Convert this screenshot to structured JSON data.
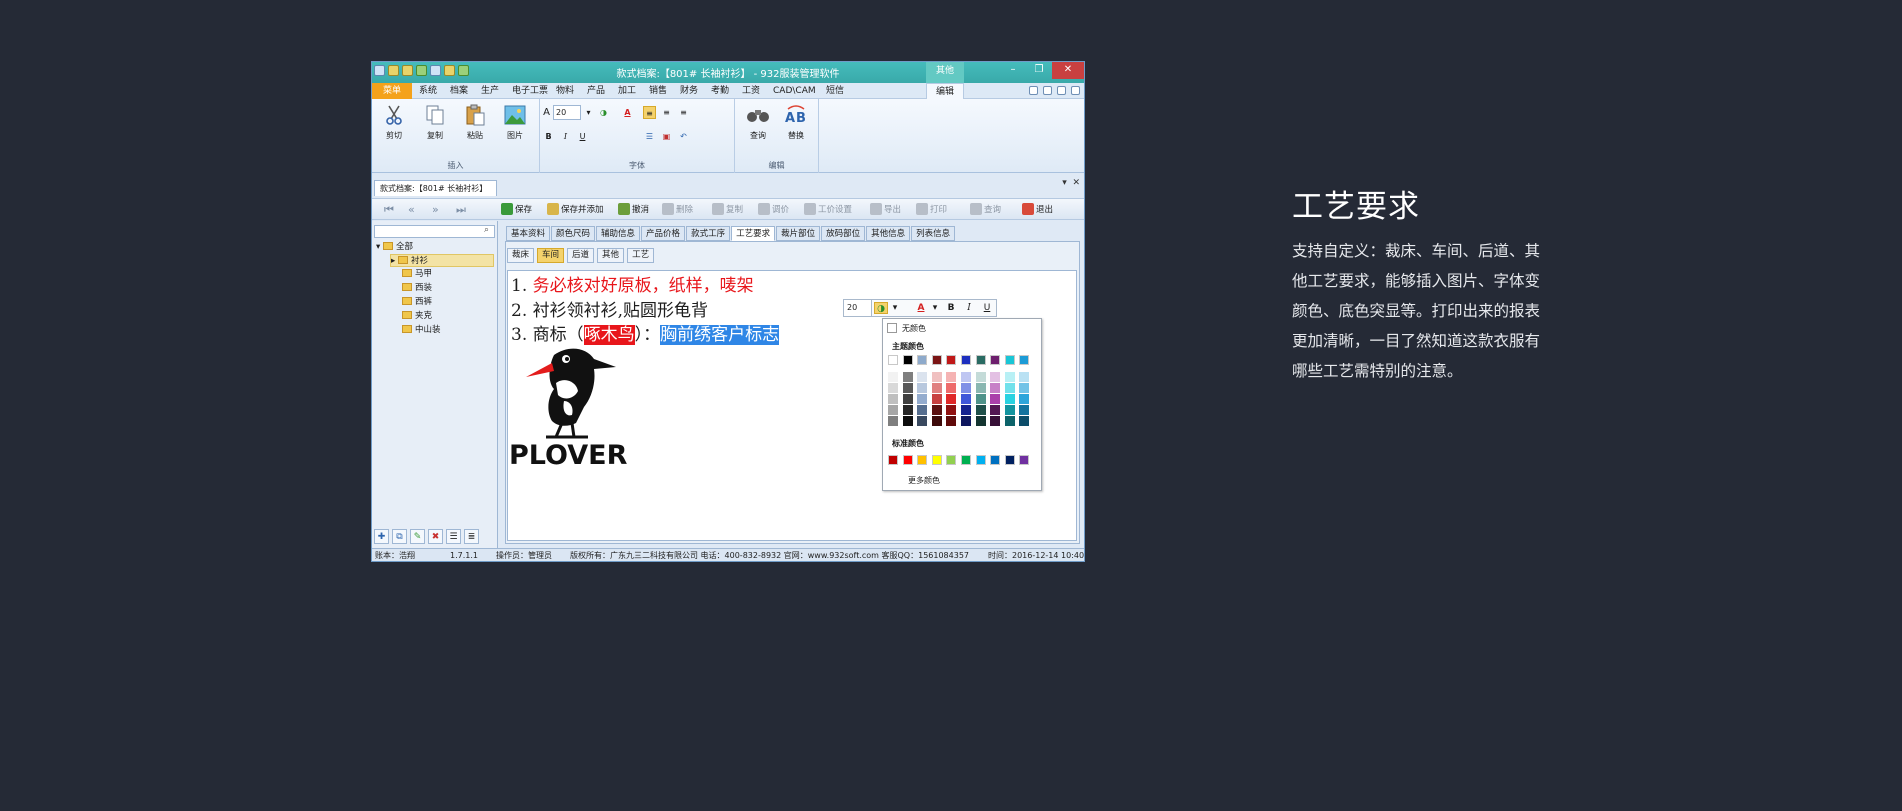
{
  "window": {
    "title": "款式档案:【801# 长袖衬衫】 - 932服装管理软件",
    "context_tab": "其他",
    "controls": [
      "–",
      "❐",
      "✕"
    ]
  },
  "menu": {
    "file": "菜单",
    "items": [
      "系统",
      "档案",
      "生产",
      "电子工票",
      "物料",
      "产品",
      "加工",
      "销售",
      "财务",
      "考勤",
      "工资",
      "CAD\\CAM",
      "短信",
      "编辑"
    ],
    "active": "编辑"
  },
  "ribbon": {
    "insert_group": {
      "label": "插入",
      "buttons": [
        "剪切",
        "复制",
        "粘贴",
        "图片"
      ]
    },
    "font_group": {
      "label": "字体",
      "size": "20",
      "bold": "B",
      "italic": "I",
      "underline": "U"
    },
    "edit_group": {
      "label": "编辑",
      "buttons": [
        "查询",
        "替换"
      ]
    }
  },
  "doc_tab": {
    "label": "款式档案:【801# 长袖衬衫】"
  },
  "toolbar": {
    "save": "保存",
    "save_add": "保存并添加",
    "cancel": "撤消",
    "delete": "删除",
    "copy": "复制",
    "adjust_price": "调价",
    "wage_setting": "工价设置",
    "export": "导出",
    "print": "打印",
    "query": "查询",
    "exit": "退出"
  },
  "tree": {
    "root": "全部",
    "items": [
      "衬衫",
      "马甲",
      "西装",
      "西裤",
      "夹克",
      "中山装"
    ],
    "selected": "衬衫"
  },
  "tabs": [
    "基本资料",
    "颜色尺码",
    "辅助信息",
    "产品价格",
    "款式工序",
    "工艺要求",
    "裁片部位",
    "放码部位",
    "其他信息",
    "列表信息"
  ],
  "active_tab": "工艺要求",
  "subtabs": [
    "裁床",
    "车间",
    "后道",
    "其他",
    "工艺"
  ],
  "active_subtab": "车间",
  "editor": {
    "line1_num": "1. ",
    "line1_text": "务必核对好原板，纸样，唛架",
    "line2": "2. 衬衫领衬衫,贴圆形龟背",
    "line3_prefix": "3. 商标（",
    "line3_brand": "啄木鸟",
    "line3_mid": "）：",
    "line3_sel": "胸前绣客户标志",
    "logo_text": "PLOVER"
  },
  "mini_toolbar": {
    "size": "20",
    "bold": "B",
    "italic": "I",
    "underline": "U"
  },
  "palette": {
    "no_color": "无颜色",
    "theme_label": "主题颜色",
    "standard_label": "标准颜色",
    "more": "更多颜色",
    "theme_top": [
      "#ffffff",
      "#000000",
      "#8eaacb",
      "#7b1515",
      "#c01818",
      "#1d2fbf",
      "#2a6b63",
      "#6d1f6d",
      "#19c6d6",
      "#1c9bd6"
    ],
    "theme_shades": [
      [
        "#f2f2f2",
        "#d9d9d9",
        "#bfbfbf",
        "#a6a6a6",
        "#7f7f7f"
      ],
      [
        "#7f7f7f",
        "#595959",
        "#404040",
        "#262626",
        "#0d0d0d"
      ],
      [
        "#dbe3ee",
        "#b8c8de",
        "#94acce",
        "#566e8f",
        "#39495f"
      ],
      [
        "#f0c0c0",
        "#e08080",
        "#c84040",
        "#5c1010",
        "#3e0a0a"
      ],
      [
        "#f5b3b3",
        "#ee6b6b",
        "#e02828",
        "#901010",
        "#600a0a"
      ],
      [
        "#bfc6f2",
        "#8090e6",
        "#4058d9",
        "#16238f",
        "#0e175f"
      ],
      [
        "#c4dbd8",
        "#8ab7b1",
        "#4f938a",
        "#1f504a",
        "#143531"
      ],
      [
        "#e3c0e3",
        "#c780c7",
        "#aa40aa",
        "#521752",
        "#360f36"
      ],
      [
        "#b8f0f5",
        "#70e1eb",
        "#29d2e1",
        "#12949f",
        "#0c636a"
      ],
      [
        "#b9e1f3",
        "#73c3e7",
        "#2da5db",
        "#13739f",
        "#0c4d6a"
      ]
    ],
    "standard": [
      "#c00000",
      "#ff0000",
      "#ffc000",
      "#ffff00",
      "#92d050",
      "#00b050",
      "#00b0f0",
      "#0070c0",
      "#002060",
      "#7030a0"
    ]
  },
  "status": {
    "account": "账本：浩翔",
    "version": "1.7.1.1",
    "operator": "操作员：管理员",
    "copyright": "版权所有：广东九三二科技有限公司 电话：400-832-8932 官网：www.932soft.com 客服QQ：1561084357",
    "time": "时间：2016-12-14 10:40"
  },
  "side": {
    "title": "工艺要求",
    "desc": "支持自定义：裁床、车间、后道、其他工艺要求，能够插入图片、字体变颜色、底色突显等。打印出来的报表更加清晰，一目了然知道这款衣服有哪些工艺需特别的注意。"
  }
}
